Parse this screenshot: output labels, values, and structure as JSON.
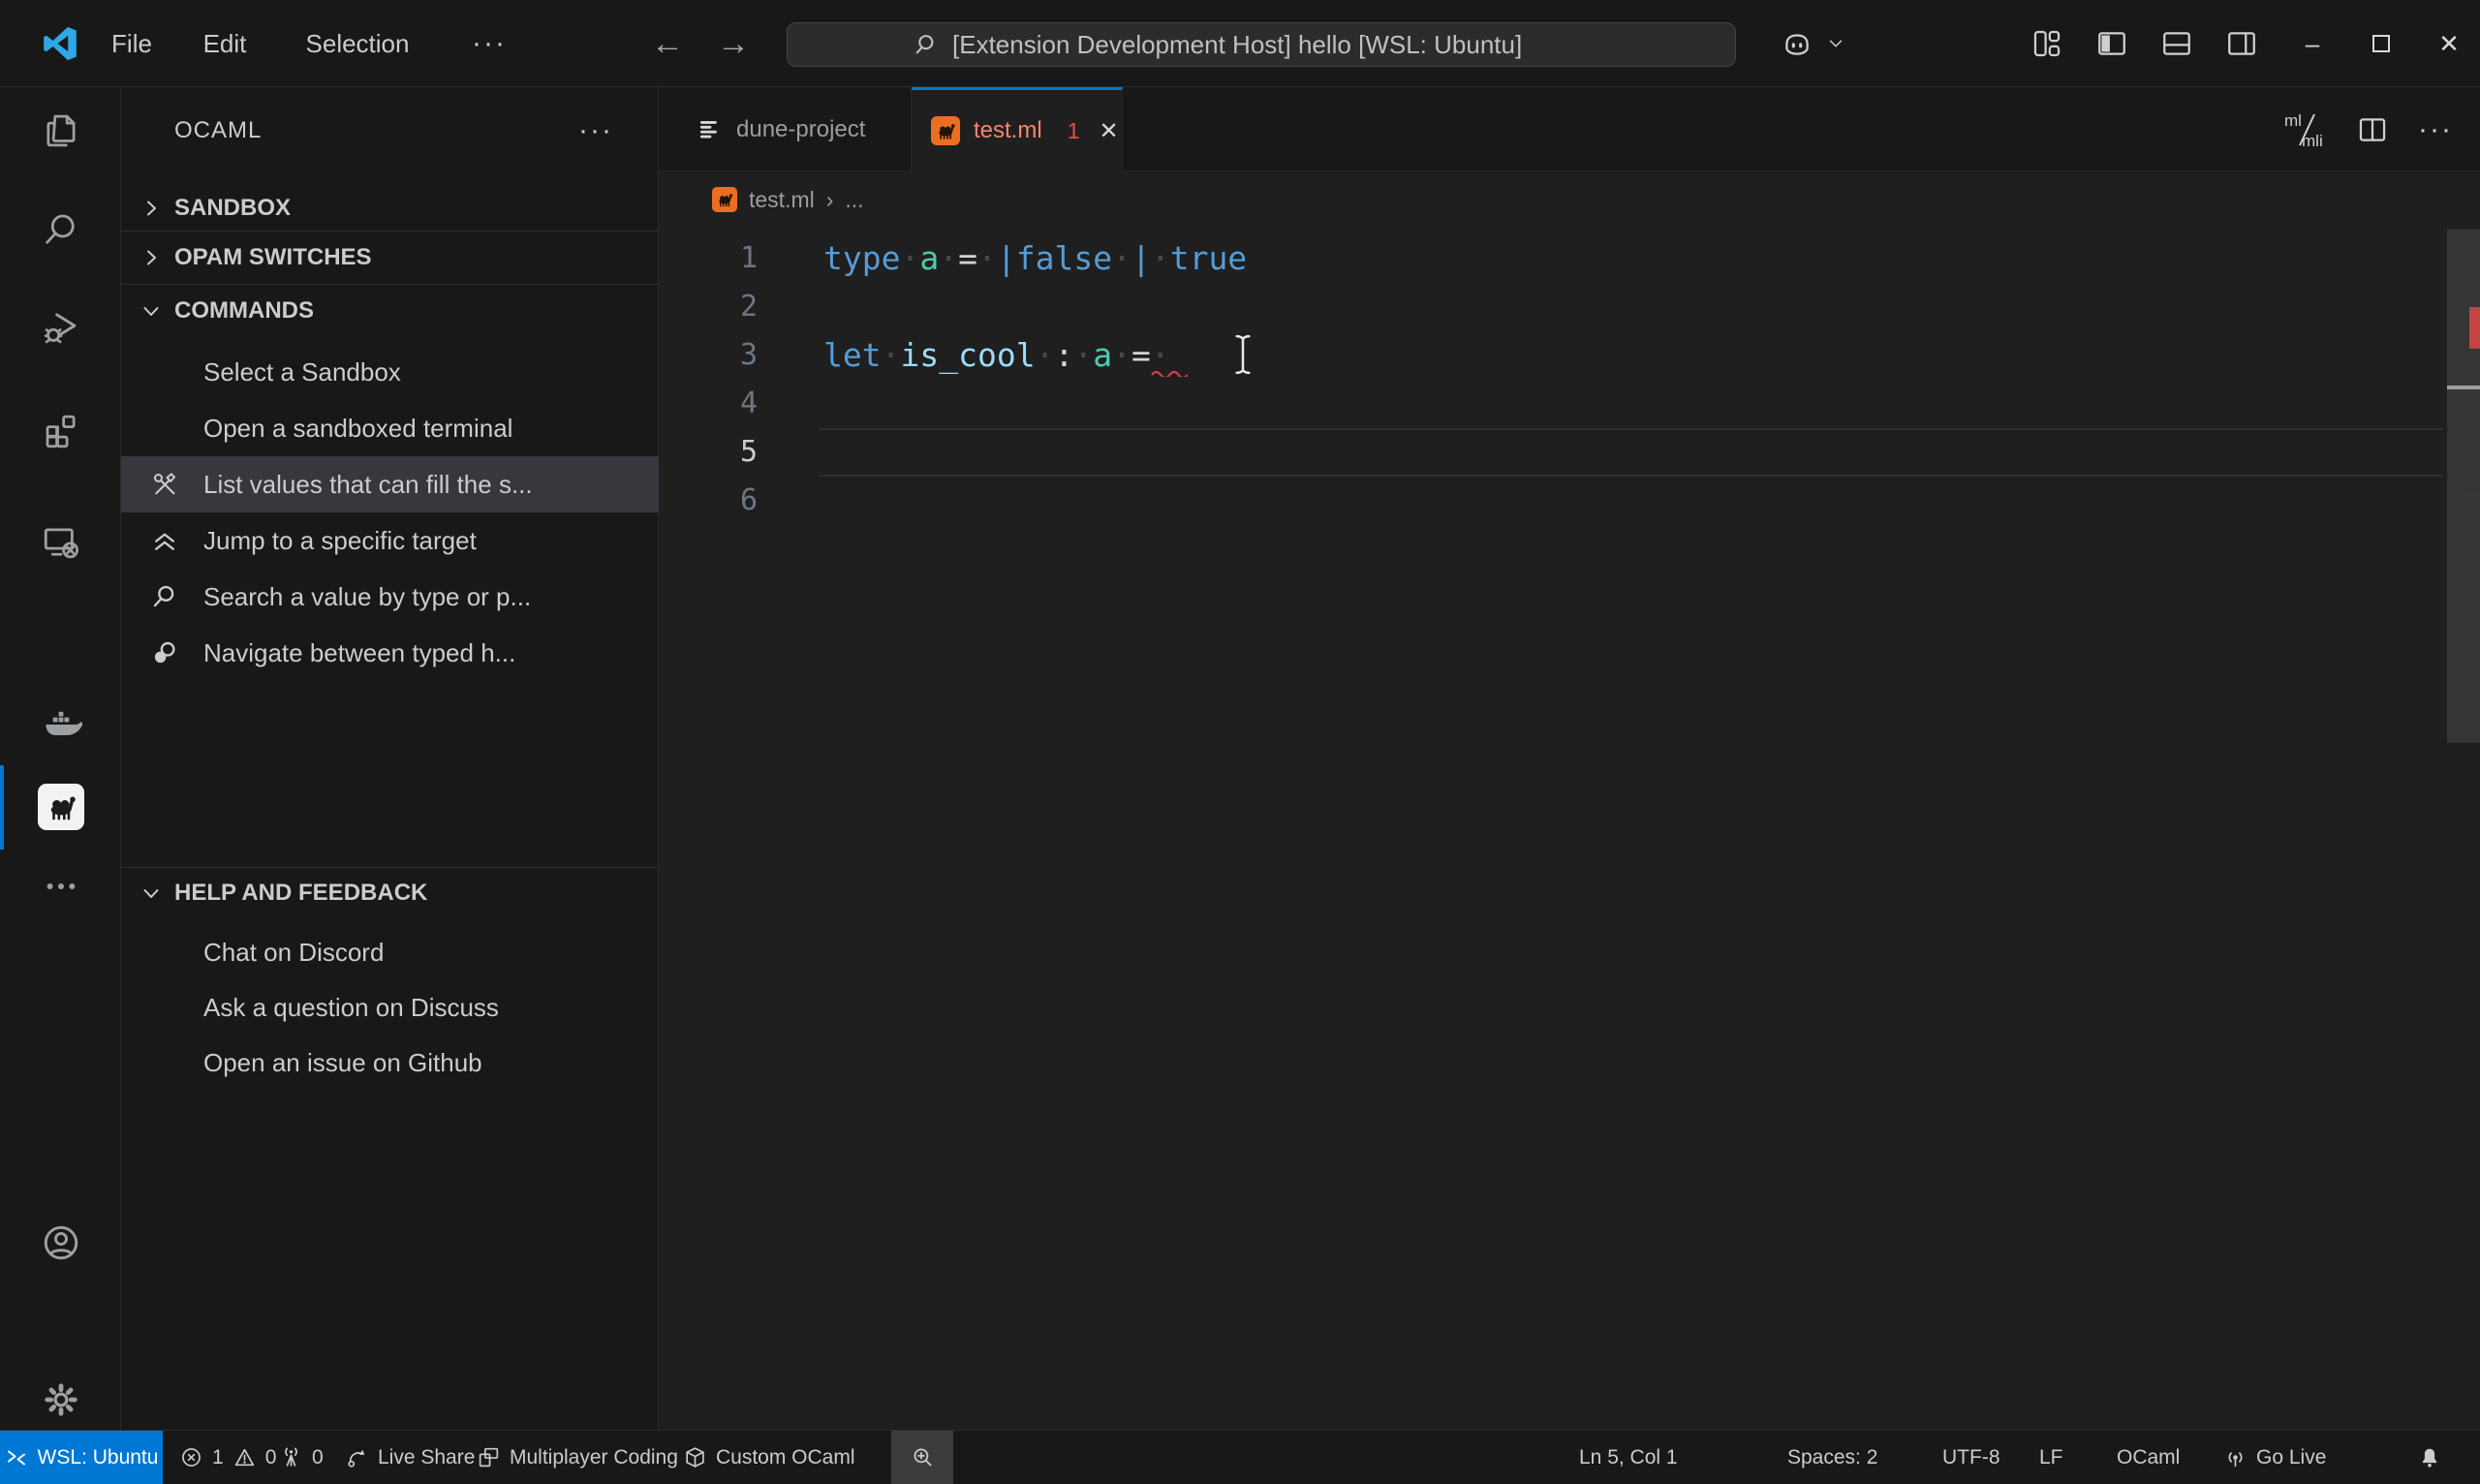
{
  "colors": {
    "accent": "#0078d4",
    "ui_background": "#181818",
    "editor_background": "#1f1f1f",
    "selection_background": "#37373d",
    "text": "#cccccc",
    "dim_text": "#9d9d9d",
    "keyword": "#569cd6",
    "type_name": "#4ec9b0",
    "identifier": "#9cdcfe",
    "operator": "#d4d4d4",
    "error_red": "#f14c4c",
    "tab_error_label": "#f48771",
    "camel_orange": "#ec6e23",
    "remote_background": "#0078d4"
  },
  "title_bar": {
    "menus": [
      "File",
      "Edit",
      "Selection"
    ],
    "menu_more": "···",
    "nav_back": "←",
    "nav_forward": "→",
    "command_center": {
      "icon": "search-icon",
      "text": "[Extension Development Host] hello [WSL: Ubuntu]"
    },
    "right_icons": [
      "copilot-icon",
      "chevron-down-icon",
      "customize-layout-icon",
      "toggle-primary-sidebar-icon",
      "toggle-panel-icon",
      "toggle-secondary-sidebar-icon"
    ],
    "minimize": "–",
    "close": "✕"
  },
  "activity_bar": {
    "items": [
      {
        "icon": "explorer-icon"
      },
      {
        "icon": "search-icon"
      },
      {
        "icon": "run-debug-icon"
      },
      {
        "icon": "extensions-icon"
      },
      {
        "icon": "remote-explorer-icon"
      },
      {
        "icon": "docker-icon"
      },
      {
        "icon": "ocaml-icon",
        "active": true
      },
      {
        "icon": "more-icon"
      },
      {
        "icon": "accounts-icon"
      },
      {
        "icon": "settings-gear-icon"
      }
    ]
  },
  "sidebar": {
    "title": "OCAML",
    "more": "···",
    "sections": {
      "sandbox": {
        "label": "SANDBOX",
        "collapsed": true
      },
      "opam": {
        "label": "OPAM SWITCHES",
        "collapsed": true
      },
      "commands": {
        "label": "COMMANDS",
        "items": [
          {
            "label": "Select a Sandbox"
          },
          {
            "label": "Open a sandboxed terminal"
          },
          {
            "label": "List values that can fill the s...",
            "icon": "tools-icon",
            "selected": true
          },
          {
            "label": "Jump to a specific target",
            "icon": "fold-up-icon"
          },
          {
            "label": "Search a value by type or p...",
            "icon": "search-icon"
          },
          {
            "label": "Navigate between typed h...",
            "icon": "holes-icon"
          }
        ]
      },
      "help": {
        "label": "HELP AND FEEDBACK",
        "items": [
          {
            "label": "Chat on Discord"
          },
          {
            "label": "Ask a question on Discuss"
          },
          {
            "label": "Open an issue on Github"
          }
        ]
      }
    }
  },
  "editor": {
    "tabs": [
      {
        "label": "dune-project",
        "icon": "dune-icon",
        "active": false
      },
      {
        "label": "test.ml",
        "icon": "ocaml-file-icon",
        "active": true,
        "badge": "1",
        "close": "✕"
      }
    ],
    "actions": {
      "impl_top": "ml",
      "impl_bottom": "mli",
      "more": "···",
      "icons": [
        "switch-impl-intf-icon",
        "split-editor-icon",
        "more-actions-icon"
      ]
    },
    "breadcrumb": {
      "file": "test.ml",
      "separator": "›",
      "more": "..."
    },
    "lines": [
      {
        "num": "1",
        "tokens": [
          {
            "t": "type",
            "c": "k"
          },
          {
            "t": "·",
            "c": "w"
          },
          {
            "t": "a",
            "c": "t"
          },
          {
            "t": "·",
            "c": "w"
          },
          {
            "t": "=",
            "c": "o"
          },
          {
            "t": "·",
            "c": "w"
          },
          {
            "t": "|false",
            "c": "k"
          },
          {
            "t": "·",
            "c": "w"
          },
          {
            "t": "|",
            "c": "k"
          },
          {
            "t": "·",
            "c": "w"
          },
          {
            "t": "true",
            "c": "k"
          }
        ]
      },
      {
        "num": "2",
        "tokens": []
      },
      {
        "num": "3",
        "tokens": [
          {
            "t": "let",
            "c": "k"
          },
          {
            "t": "·",
            "c": "w"
          },
          {
            "t": "is_cool",
            "c": "v"
          },
          {
            "t": "·",
            "c": "w"
          },
          {
            "t": ":",
            "c": "o"
          },
          {
            "t": "·",
            "c": "w"
          },
          {
            "t": "a",
            "c": "t"
          },
          {
            "t": "·",
            "c": "w"
          },
          {
            "t": "=",
            "c": "o"
          },
          {
            "t": "·",
            "c": "w"
          }
        ]
      },
      {
        "num": "4",
        "tokens": []
      },
      {
        "num": "5",
        "tokens": [],
        "current": true
      },
      {
        "num": "6",
        "tokens": []
      }
    ],
    "cursor": {
      "line": 5,
      "col": 1
    },
    "decorations": {
      "error_squiggle_line": 3,
      "overview_error": "error-mark"
    }
  },
  "status_bar": {
    "remote": {
      "icon": "remote-icon",
      "label": "WSL: Ubuntu"
    },
    "problems": {
      "error_icon": "error-circle-icon",
      "errors": "1",
      "warning_icon": "warning-triangle-icon",
      "warnings": "0"
    },
    "ports": {
      "icon": "broadcast-tower-icon",
      "count": "0"
    },
    "live_share": {
      "icon": "live-share-icon",
      "label": "Live Share"
    },
    "multiplayer": {
      "icon": "multiplayer-icon",
      "label": "Multiplayer Coding"
    },
    "custom_ocaml": {
      "icon": "package-icon",
      "label": "Custom OCaml"
    },
    "zoom": {
      "icon": "zoom-in-icon"
    },
    "ln_col": "Ln 5, Col 1",
    "spaces": "Spaces: 2",
    "encoding": "UTF-8",
    "eol": "LF",
    "language": "OCaml",
    "go_live": {
      "icon": "go-live-icon",
      "label": "Go Live"
    },
    "bell": {
      "icon": "bell-icon"
    }
  }
}
